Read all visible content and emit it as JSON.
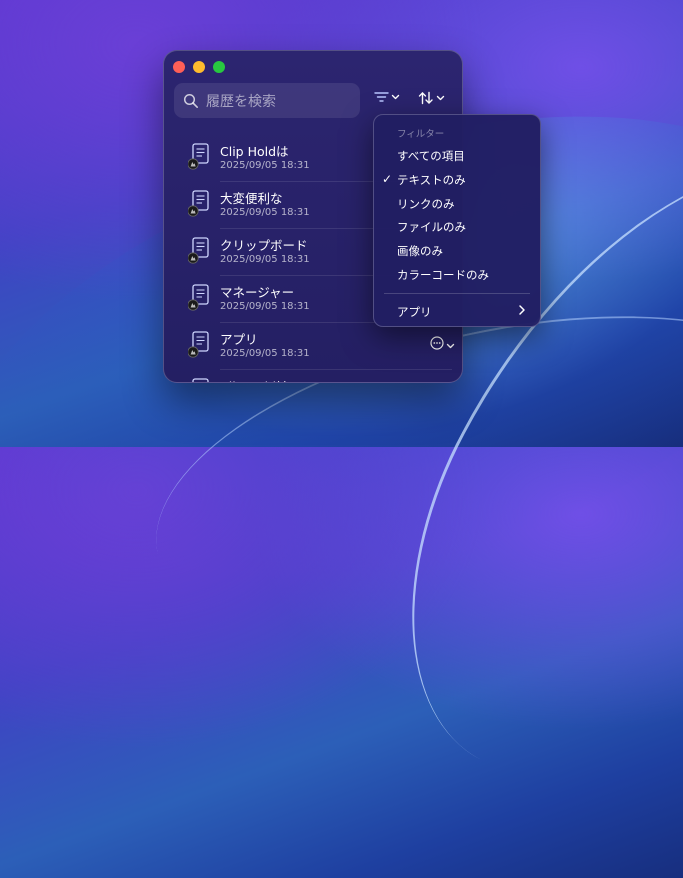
{
  "window": {
    "search": {
      "placeholder": "履歴を検索"
    },
    "toolbar": {
      "filter_icon": "filter-lines-icon",
      "sort_icon": "sort-arrows-icon"
    },
    "items": [
      {
        "title": "Clip Holdは",
        "date": "2025/09/05 18:31"
      },
      {
        "title": "大変便利な",
        "date": "2025/09/05 18:31"
      },
      {
        "title": "クリップボード",
        "date": "2025/09/05 18:31"
      },
      {
        "title": "マネージャー",
        "date": "2025/09/05 18:31"
      },
      {
        "title": "アプリ",
        "date": "2025/09/05 18:31"
      },
      {
        "title": "Clip Holdは",
        "date": ""
      }
    ]
  },
  "filter_menu": {
    "header": "フィルター",
    "items": [
      {
        "label": "すべての項目",
        "checked": false
      },
      {
        "label": "テキストのみ",
        "checked": true
      },
      {
        "label": "リンクのみ",
        "checked": false
      },
      {
        "label": "ファイルのみ",
        "checked": false
      },
      {
        "label": "画像のみ",
        "checked": false
      },
      {
        "label": "カラーコードのみ",
        "checked": false
      }
    ],
    "check_mark": "✓",
    "apps_label": "アプリ"
  },
  "colors": {
    "window_bg": "#2c2570",
    "traffic_red": "#fe5f57",
    "traffic_yellow": "#febc2e",
    "traffic_green": "#28c840"
  }
}
